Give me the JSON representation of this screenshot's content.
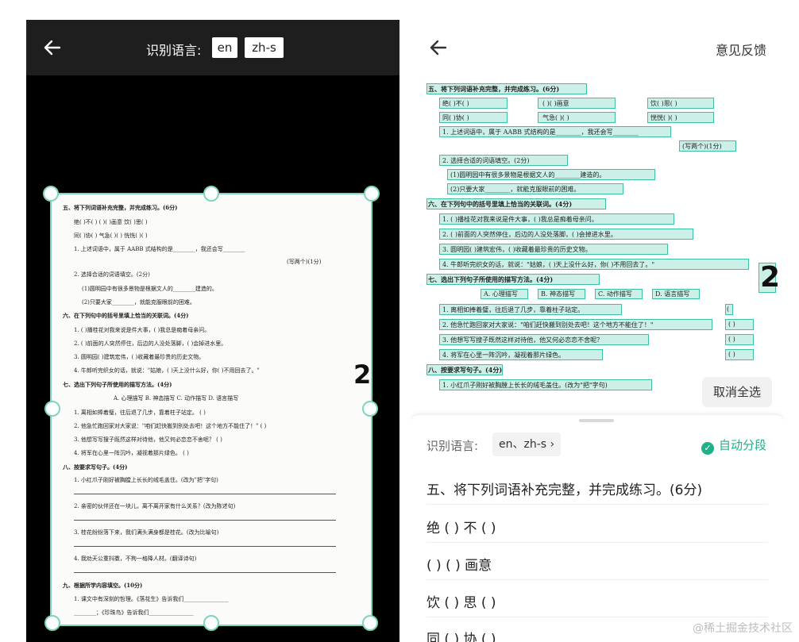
{
  "left_panel": {
    "lang_label": "识别语言:",
    "chip_en": "en",
    "chip_zh": "zh-s",
    "page_number": "2",
    "doc_lines": [
      "五、将下列词语补充完整，并完成练习。(6分)",
      "绝(    )不(    )        (    )(    )画意        饮(    )思(    )",
      "同(    )协(    )        气急(    )(    )        恍恍(    )(    )",
      "1. 上述词语中，属于 AABB 式结构的是________，我还会写________",
      "(写两个)(1分)",
      "2. 选择合适的词语填空。(2分)",
      "(1)圆明园中有很多景物是根据文人的________建造的。",
      "(2)只要大家________，就能克服眼前的困难。",
      "六、在下列句中的括号里填上恰当的关联词。(4分)",
      "1. (      )播桂花对我来说是件大事，(      )我总是痴着母亲问。",
      "2. (      )前面的人突然停住，后边的人没处落脚，(      )会掉进水里。",
      "3. 圆明园(      )建筑宏伟，(      )收藏着最珍贵的历史文物。",
      "4. 牛郎听完织女的话，就说：\"姑娘，(      )天上没什么好，你(      )不用回去了。\"",
      "七、选出下列句子所使用的描写方法。(4分)",
      "A. 心理描写     B. 神态描写     C. 动作描写     D. 语言描写",
      "1. 离相如捧着璧，往后退了几步，靠着柱子站定。                        (      )",
      "2. 他急忙跑回家对大家说：\"咱们赶快搬到别处去吧！这个地方不能住了！\"    (      )",
      "3. 他想写写搜子既然这样对待他，他又何必恋恋不舍呢？                    (      )",
      "4. 将军在心里一阵沉吟，凝视着那片绿色。                                (      )",
      "八、按要求写句子。(4分)",
      "1. 小红爪子刚好被胸膛上长长的绒毛盖住。(改为\"把\"字句)",
      "2. 亲密的伙伴还在一块儿，离不离开家有什么关系？(改为陈述句)",
      "3. 桂花纷纷落下来，我们满头满身都是桂花。(改为比喻句)",
      "4. 我劝天公重抖擞，不拘一格降人材。(翻译诗句)",
      "九、根据所学内容填空。(10分)",
      "1. 课文中有深刻的哲理。《落花生》告诉我们________________",
      "________；《珍珠鸟》告诉我们________________"
    ]
  },
  "right_panel": {
    "feedback": "意见反馈",
    "page_number": "2",
    "scan_lines": [
      "五、将下列词语补充完整，并完成练习。(6分)",
      "绝(    )不(    )",
      "(    )(    )画意",
      "饮(    )思(    )",
      "同(    )协(    )",
      "气急(    )(    )",
      "恍恍(    )(    )",
      "1. 上述词语中，属于 AABB 式结构的是________，我还会写________",
      "(写两个)(1分)",
      "2. 选择合适的词语填空。(2分)",
      "(1)圆明园中有很多景物是根据文人的________建造的。",
      "(2)只要大家________，就能克服眼前的困难。",
      "六、在下列句中的括号里填上恰当的关联词。(4分)",
      "1. (      )播桂花对我来说是件大事，(      )我总是痴着母亲问。",
      "2. (      )前面的人突然停住，后边的人没处落脚，(      )会掉进水里。",
      "3. 圆明园(      )建筑宏伟，(      )收藏着最珍贵的历史文物。",
      "4. 牛郎听完织女的话，就说：\"姑娘，(      )天上没什么好，你(      )不用回去了。\"",
      "七、选出下列句子所使用的描写方法。(4分)",
      "A. 心理描写",
      "B. 神态描写",
      "C. 动作描写",
      "D. 语言描写",
      "1. 离相如捧着璧，往后退了几步，靠着柱子站定。",
      "2. 他急忙跑回家对大家说：\"咱们赶快搬到别处去吧！这个地方不能住了！\"",
      "3. 他想写写搜子既然这样对待他，他又何必恋恋不舍呢？",
      "4. 将军在心里一阵沉吟，凝视着那片绿色。",
      "八、按要求写句子。(4分)",
      "1. 小红爪子刚好被胸膛上长长的绒毛盖住。(改为\"把\"字句)",
      "(",
      "(      )",
      "(      )",
      "(      )"
    ],
    "deselect_all": "取消全选",
    "sheet_lang_label": "识别语言:",
    "sheet_lang_value": "en、zh-s",
    "auto_segment": "自动分段",
    "paragraphs": [
      "五、将下列词语补充完整，并完成练习。(6分)",
      "绝 ( ) 不 ( )",
      "( ) ( ) 画意",
      "饮 ( ) 思 ( )",
      "同 ( ) 协 ( )"
    ]
  },
  "watermark": "@稀土掘金技术社区",
  "colors": {
    "accent": "#1fb28a",
    "handle_border": "#7fd4bd",
    "highlight": "#78d7c3"
  }
}
